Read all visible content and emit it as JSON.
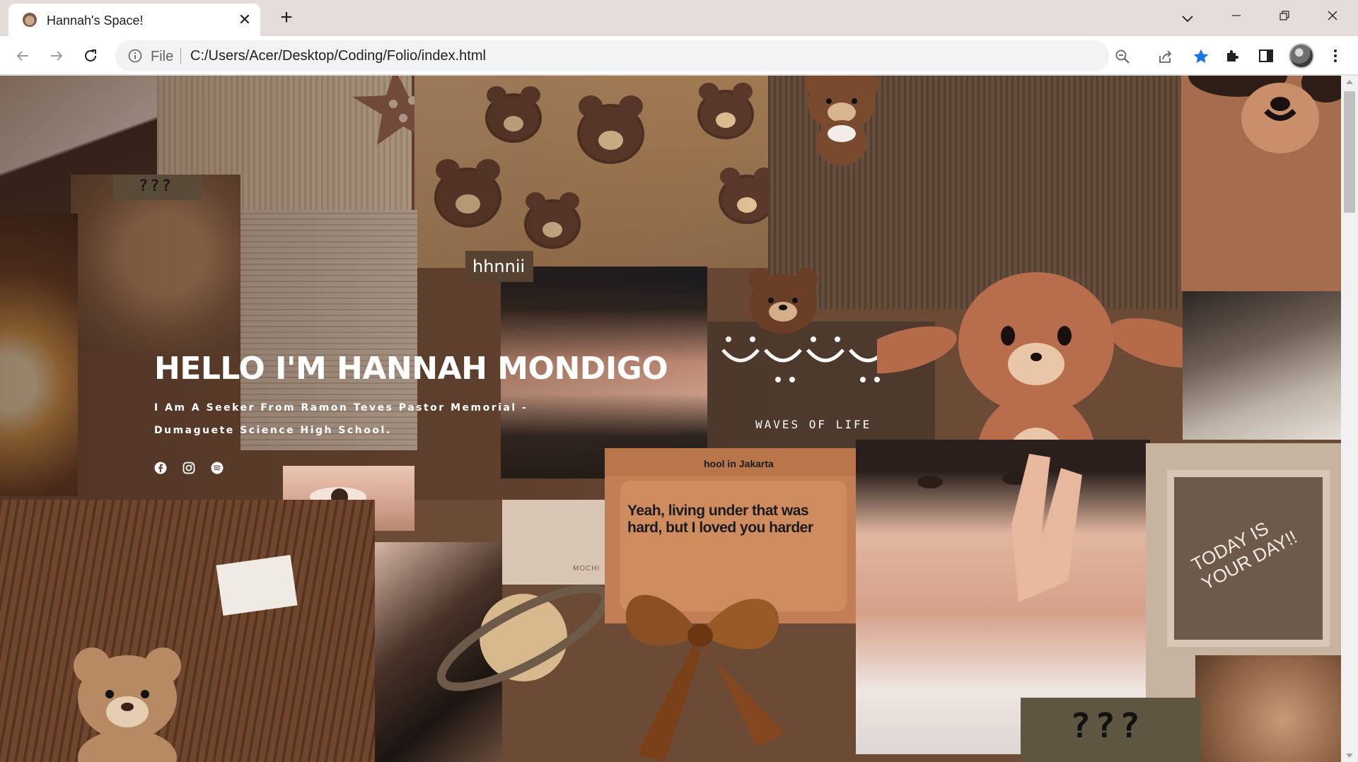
{
  "browser": {
    "tab_title": "Hannah's Space!",
    "url_scheme_label": "File",
    "url": "C:/Users/Acer/Desktop/Coding/Folio/index.html"
  },
  "hero": {
    "name": "HELLO I'M HANNAH MONDIGO",
    "tagline": "I Am A Seeker From Ramon Teves Pastor Memorial - Dumaguete Science High School."
  },
  "collage": {
    "top_sticker": "???",
    "photo_caption": "hhnnii",
    "waves_label": "WAVES OF LIFE",
    "message_header": "hool in Jakarta",
    "message_body": "Yeah, living under that was hard, but I loved you harder",
    "mug_text": "MOCHI",
    "today_sign": "TODAY IS YOUR DAY!!",
    "bottom_sticker": "???"
  },
  "icons": {
    "social": [
      "facebook-icon",
      "instagram-icon",
      "spotify-icon"
    ]
  },
  "colors": {
    "accent_star": "#1a73e8",
    "collage_brown": "#6b4a36",
    "tag_brown": "#574232"
  }
}
